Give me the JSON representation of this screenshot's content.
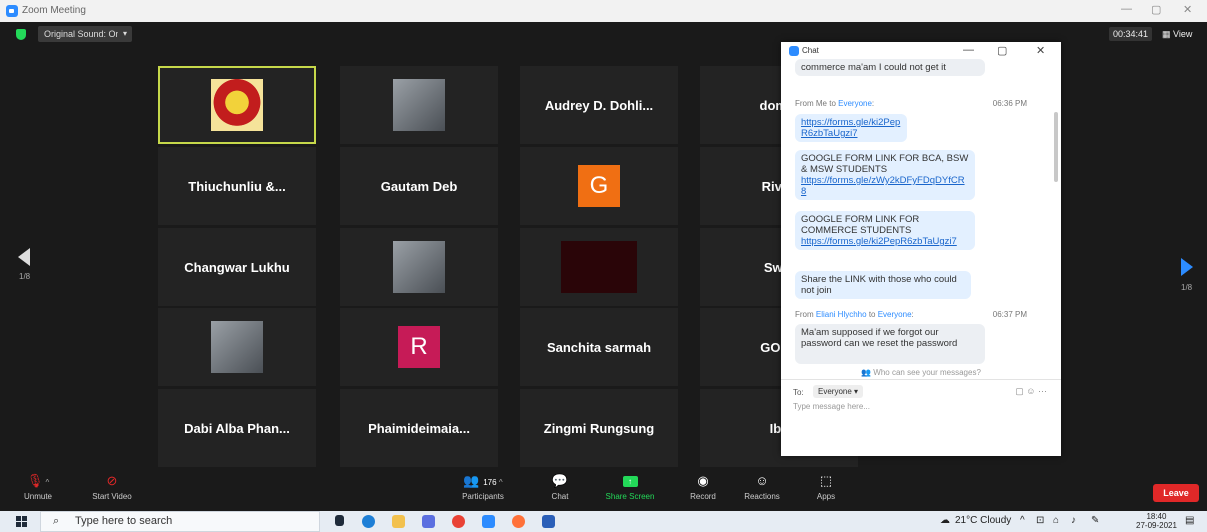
{
  "window": {
    "title": "Zoom Meeting"
  },
  "topbar": {
    "original_sound": "Original Sound: On",
    "timer": "00:34:41",
    "view_label": "View"
  },
  "pager": {
    "left": "1/8",
    "right": "1/8"
  },
  "grid": [
    {
      "type": "logo",
      "name": "college-logo-tile",
      "active": true
    },
    {
      "type": "photo",
      "name": "participant-photo-tile"
    },
    {
      "type": "name",
      "name": "Audrey D. Dohli..."
    },
    {
      "type": "name",
      "name": "domin"
    },
    {
      "type": "name",
      "name": "Thiuchunliu &..."
    },
    {
      "type": "name",
      "name": "Gautam Deb"
    },
    {
      "type": "letter",
      "letter": "G",
      "color": "#f06f13"
    },
    {
      "type": "name",
      "name": "Rivak"
    },
    {
      "type": "name",
      "name": "Changwar Lukhu"
    },
    {
      "type": "photo",
      "name": "participant-photo-tile"
    },
    {
      "type": "dark",
      "name": "video-off-tile"
    },
    {
      "type": "name",
      "name": "Swat"
    },
    {
      "type": "photo",
      "name": "participant-photo-tile"
    },
    {
      "type": "letter",
      "letter": "R",
      "color": "#c61b57"
    },
    {
      "type": "name",
      "name": "Sanchita sarmah"
    },
    {
      "type": "name",
      "name": "GOUT"
    },
    {
      "type": "name",
      "name": "Dabi Alba Phan..."
    },
    {
      "type": "name",
      "name": "Phaimideimaia..."
    },
    {
      "type": "name",
      "name": "Zingmi Rungsung"
    },
    {
      "type": "name",
      "name": "Iba"
    }
  ],
  "chat": {
    "title": "Chat",
    "msg0": "commerce ma'am I could not get it",
    "meta1": {
      "from": "From Me to ",
      "to": "Everyone",
      "suffix": ":",
      "time": "06:36 PM"
    },
    "msg1_link": "https://forms.gle/ki2PepR6zbTaUgzi7",
    "msg2_text": "GOOGLE FORM LINK FOR BCA, BSW & MSW STUDENTS",
    "msg2_link": "https://forms.gle/zWy2kDFyFDqDYfCR8",
    "msg3_text": "GOOGLE FORM LINK FOR COMMERCE STUDENTS",
    "msg3_link": "https://forms.gle/ki2PepR6zbTaUgzi7",
    "msg4": "Share the LINK with those who could not join",
    "meta2": {
      "from": "From ",
      "sender": "Eliani Hlychho",
      "mid": " to ",
      "to": "Everyone",
      "suffix": ":",
      "time": "06:37 PM"
    },
    "msg5": "Ma'am supposed if we forgot our password can we reset the password",
    "who": "Who can see your messages?",
    "to_label": "To:",
    "to_value": "Everyone",
    "placeholder": "Type message here..."
  },
  "toolbar": {
    "unmute": "Unmute",
    "start_video": "Start Video",
    "participants": "Participants",
    "participant_count": "176",
    "chat": "Chat",
    "share": "Share Screen",
    "record": "Record",
    "reactions": "Reactions",
    "apps": "Apps",
    "leave": "Leave"
  },
  "taskbar": {
    "search_placeholder": "Type here to search",
    "weather": "21°C  Cloudy",
    "time": "18:40",
    "date": "27-09-2021"
  },
  "colors": {
    "accent": "#2d8cff",
    "share_green": "#23d959",
    "leave_red": "#e02828",
    "active_border": "#c6d84a"
  }
}
